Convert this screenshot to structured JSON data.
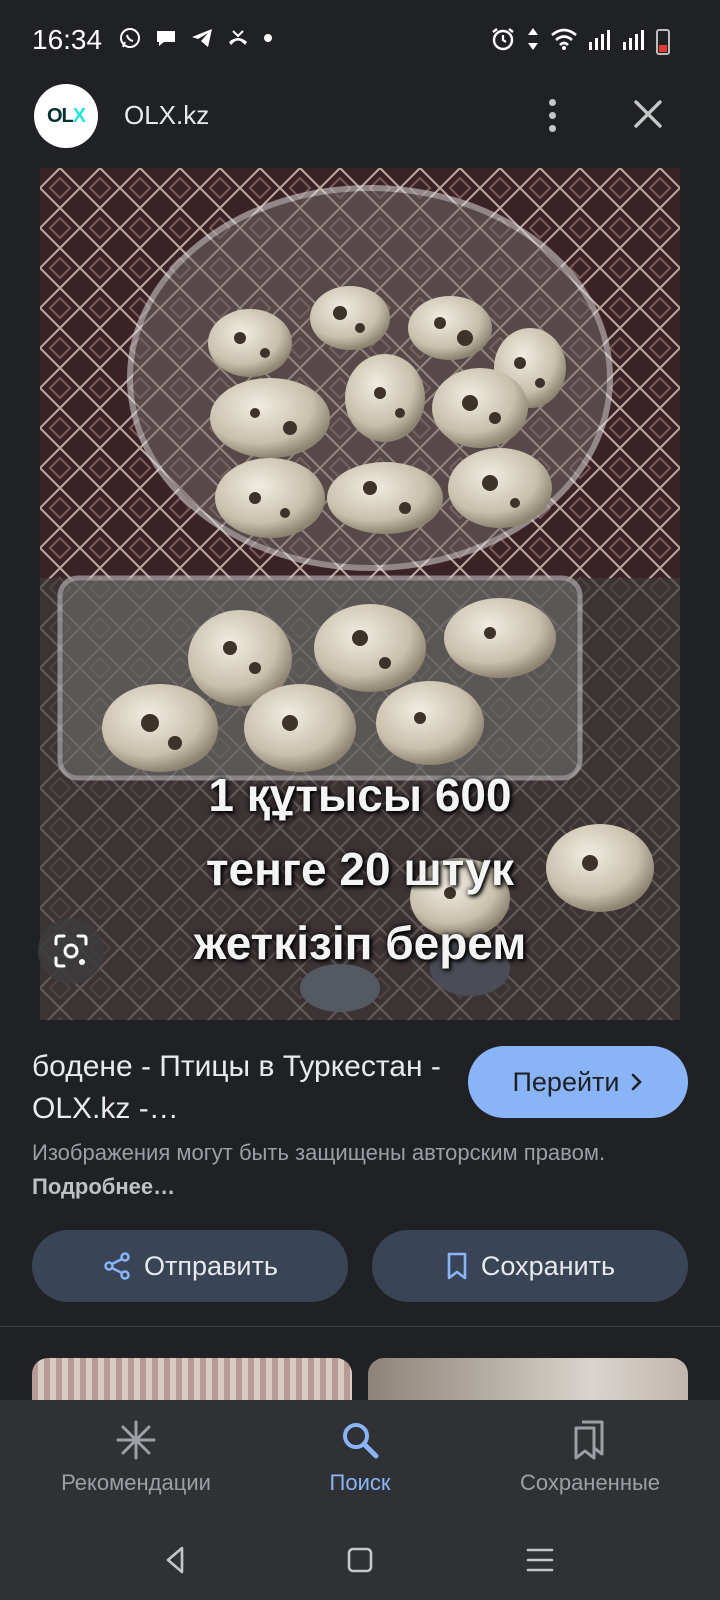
{
  "status_bar": {
    "time": "16:34"
  },
  "header": {
    "site_name": "OLX.kz",
    "logo_text_a": "OL",
    "logo_text_b": "X"
  },
  "image": {
    "overlay_lines": [
      "1 құтысы 600",
      "тенге 20 штук",
      "жеткізіп берем"
    ]
  },
  "result": {
    "title": "бодене - Птицы в Туркестан - OLX.kz -…",
    "visit_label": "Перейти",
    "copyright_text": "Изображения могут быть защищены авторским правом.",
    "copyright_more": "Подробнее…"
  },
  "actions": {
    "share_label": "Отправить",
    "save_label": "Сохранить"
  },
  "bottom_nav": {
    "items": [
      {
        "label": "Рекомендации",
        "icon": "asterisk-icon",
        "active": false
      },
      {
        "label": "Поиск",
        "icon": "search-icon",
        "active": true
      },
      {
        "label": "Сохраненные",
        "icon": "bookmarks-icon",
        "active": false
      }
    ]
  },
  "colors": {
    "accent": "#8ab4f8",
    "background": "#202124",
    "action_button": "#394457"
  }
}
